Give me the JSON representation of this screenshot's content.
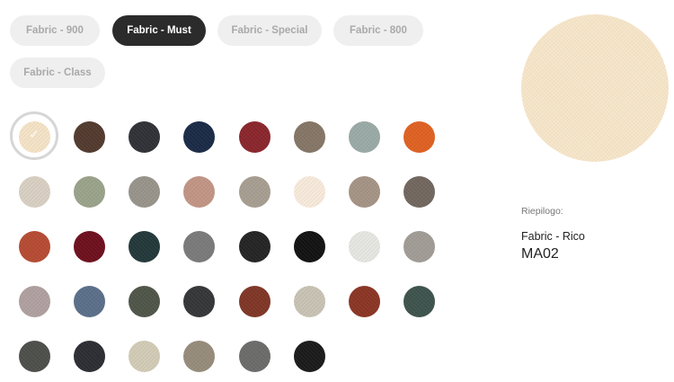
{
  "tabs": [
    {
      "label": "Fabric - 900",
      "active": false
    },
    {
      "label": "Fabric - Must",
      "active": true
    },
    {
      "label": "Fabric - Special",
      "active": false
    },
    {
      "label": "Fabric - 800",
      "active": false
    },
    {
      "label": "Fabric - Class",
      "active": false
    }
  ],
  "swatch_rows": [
    [
      "#f4e3c6",
      "#523a2e",
      "#2f3136",
      "#1a2a46",
      "#8a262c",
      "#857666",
      "#9aaaa6",
      "#df6122"
    ],
    [
      "#d9d0c3",
      "#9aa38a",
      "#98948b",
      "#c29585",
      "#a79e91",
      "#f7eadb",
      "#a59485",
      "#72675f"
    ],
    [
      "#b64b33",
      "#6e0f1d",
      "#23383a",
      "#7a7a7a",
      "#242424",
      "#121212",
      "#e6e6e2",
      "#a19c96"
    ],
    [
      "#b0a0a0",
      "#5b6f8a",
      "#4f5649",
      "#343638",
      "#7f3626",
      "#c8c3b4",
      "#8b3524",
      "#3e534d"
    ],
    [
      "#4d4f4b",
      "#2c2d33",
      "#d2cbb6",
      "#978c7b",
      "#6b6c6a",
      "#1a1a1a"
    ]
  ],
  "selected_index": 0,
  "check_icon": "check-icon",
  "preview_color": "#f4e3c6",
  "summary": {
    "label": "Riepilogo:",
    "name": "Fabric - Rico",
    "code": "MA02"
  }
}
